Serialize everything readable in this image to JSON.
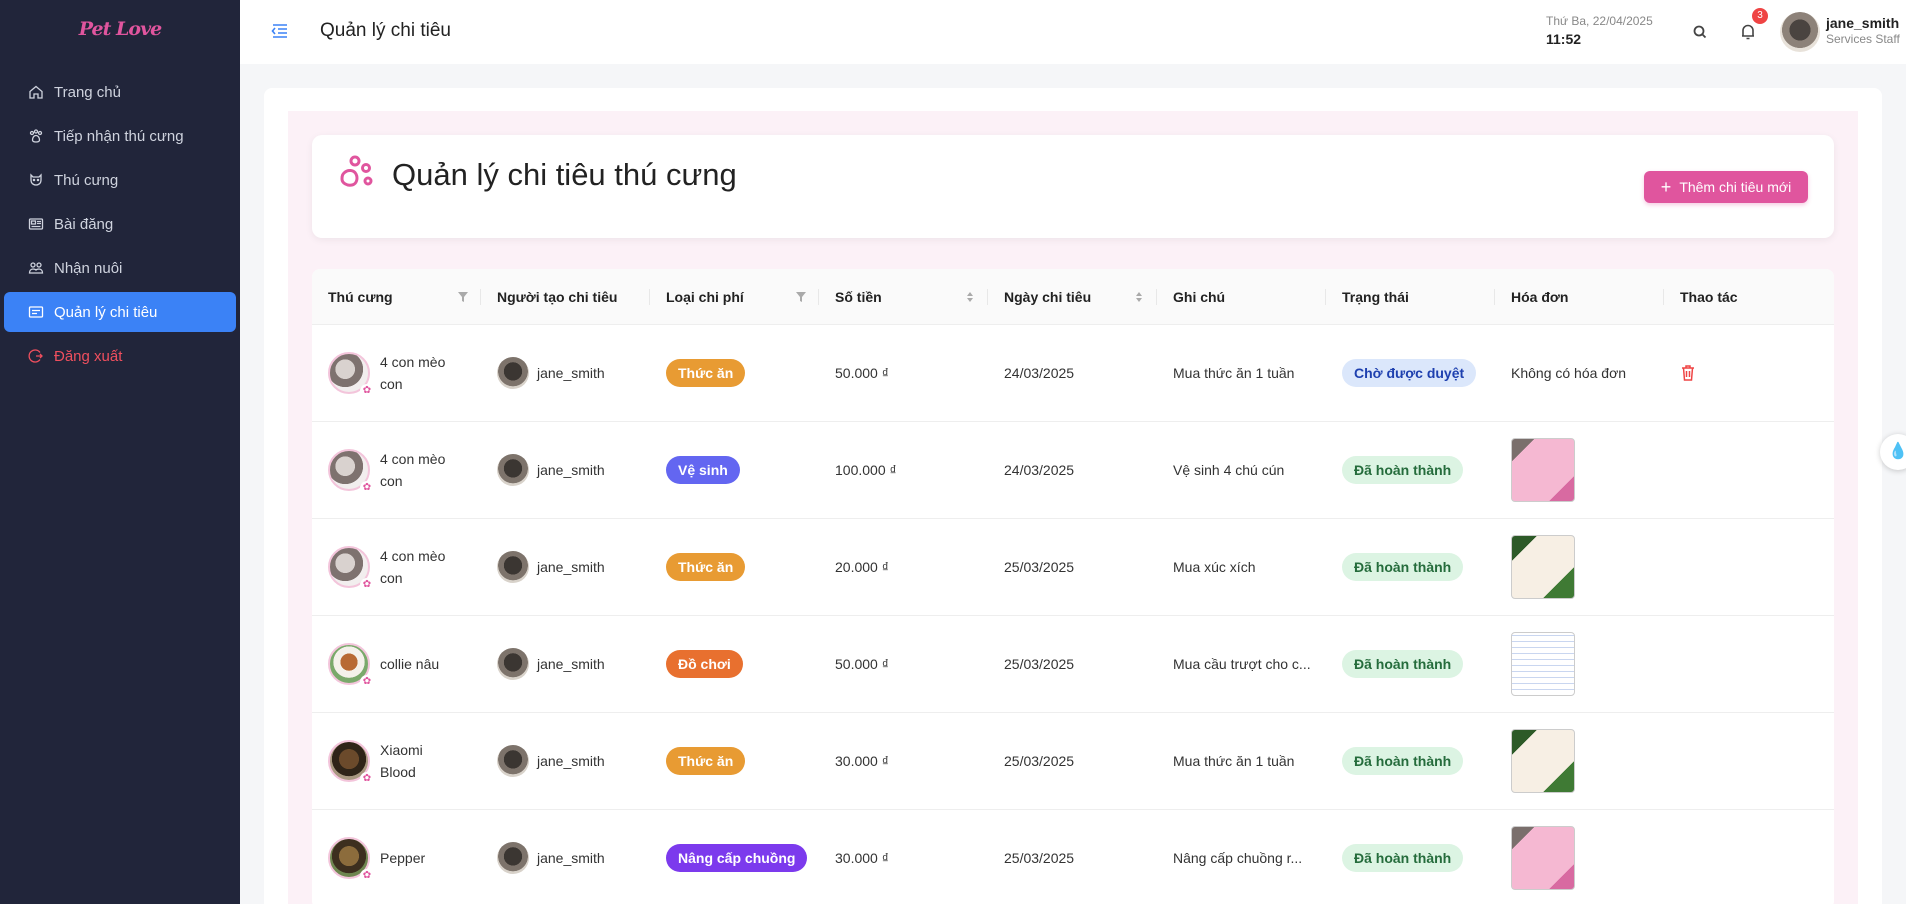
{
  "app": {
    "logo_text": "Pet Love"
  },
  "sidebar": {
    "items": [
      {
        "label": "Trang chủ",
        "icon": "home-icon"
      },
      {
        "label": "Tiếp nhận thú cưng",
        "icon": "paw-icon"
      },
      {
        "label": "Thú cưng",
        "icon": "pet-icon"
      },
      {
        "label": "Bài đăng",
        "icon": "article-icon"
      },
      {
        "label": "Nhận nuôi",
        "icon": "adopt-icon"
      },
      {
        "label": "Quản lý chi tiêu",
        "icon": "wallet-icon",
        "active": true
      },
      {
        "label": "Đăng xuất",
        "icon": "logout-icon",
        "danger": true
      }
    ]
  },
  "header": {
    "title": "Quản lý chi tiêu",
    "date": "Thứ Ba, 22/04/2025",
    "time": "11:52",
    "notification_count": "3",
    "user_name": "jane_smith",
    "user_role": "Services Staff"
  },
  "main": {
    "heading": "Quản lý chi tiêu thú cưng",
    "add_button_label": "Thêm chi tiêu mới"
  },
  "table": {
    "columns": [
      "Thú cưng",
      "Người tạo chi tiêu",
      "Loại chi phí",
      "Số tiền",
      "Ngày chi tiêu",
      "Ghi chú",
      "Trạng thái",
      "Hóa đơn",
      "Thao tác"
    ],
    "rows": [
      {
        "pet": "4 con mèo con",
        "creator": "jane_smith",
        "type": "Thức ăn",
        "type_color": "#e89b33",
        "amount": "50.000 ₫",
        "date": "24/03/2025",
        "note": "Mua thức ăn 1 tuần",
        "status": "Chờ được duyệt",
        "status_kind": "pending",
        "invoice": "Không có hóa đơn",
        "has_invoice": false
      },
      {
        "pet": "4 con mèo con",
        "creator": "jane_smith",
        "type": "Vệ sinh",
        "type_color": "#6366f1",
        "amount": "100.000 ₫",
        "date": "24/03/2025",
        "note": "Vệ sinh 4 chú cún",
        "status": "Đã hoàn thành",
        "status_kind": "done",
        "invoice": "",
        "has_invoice": true,
        "thumb": "pink"
      },
      {
        "pet": "4 con mèo con",
        "creator": "jane_smith",
        "type": "Thức ăn",
        "type_color": "#e89b33",
        "amount": "20.000 ₫",
        "date": "25/03/2025",
        "note": "Mua xúc xích",
        "status": "Đã hoàn thành",
        "status_kind": "done",
        "invoice": "",
        "has_invoice": true,
        "thumb": "green"
      },
      {
        "pet": "collie nâu",
        "creator": "jane_smith",
        "type": "Đồ chơi",
        "type_color": "#e8702f",
        "amount": "50.000 ₫",
        "date": "25/03/2025",
        "note": "Mua cầu trượt cho c...",
        "status": "Đã hoàn thành",
        "status_kind": "done",
        "invoice": "",
        "has_invoice": true,
        "thumb": "doc"
      },
      {
        "pet": "Xiaomi Blood",
        "creator": "jane_smith",
        "type": "Thức ăn",
        "type_color": "#e89b33",
        "amount": "30.000 ₫",
        "date": "25/03/2025",
        "note": "Mua thức ăn 1 tuần",
        "status": "Đã hoàn thành",
        "status_kind": "done",
        "invoice": "",
        "has_invoice": true,
        "thumb": "green"
      },
      {
        "pet": "Pepper",
        "creator": "jane_smith",
        "type": "Nâng cấp chuồng",
        "type_color": "#7c3aed",
        "amount": "30.000 ₫",
        "date": "25/03/2025",
        "note": "Nâng cấp chuồng r...",
        "status": "Đã hoàn thành",
        "status_kind": "done",
        "invoice": "",
        "has_invoice": true,
        "thumb": "pink"
      }
    ]
  },
  "colors": {
    "accent": "#3b82f6",
    "brand_pink": "#e0559e",
    "sidebar_bg": "#21253a",
    "danger": "#ef4444"
  }
}
